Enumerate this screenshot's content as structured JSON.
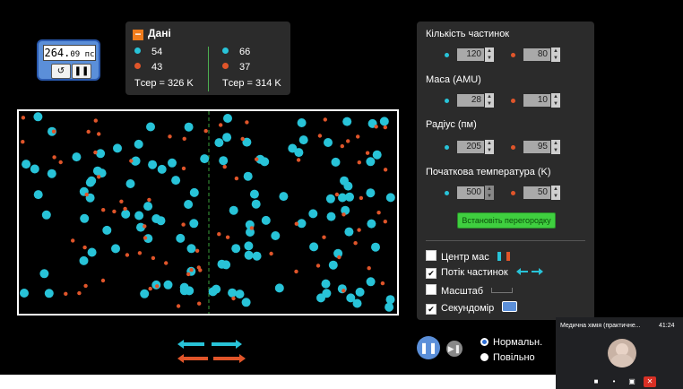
{
  "stopwatch": {
    "value": "264.",
    "decimals": "09",
    "unit": " пс",
    "reset_icon": "reset-icon",
    "pause_icon": "pause-icon"
  },
  "data_panel": {
    "title": "Дані",
    "left": {
      "blue_count": "54",
      "red_count": "43",
      "t_avg": "Tсер = 326 K"
    },
    "right": {
      "blue_count": "66",
      "red_count": "37",
      "t_avg": "Tсер = 314 K"
    }
  },
  "controls": {
    "count_label": "Кількість частинок",
    "count_blue": "120",
    "count_red": "80",
    "mass_label": "Маса (AMU)",
    "mass_blue": "28",
    "mass_red": "10",
    "radius_label": "Радіус (пм)",
    "radius_blue": "205",
    "radius_red": "95",
    "temp_label": "Початкова температура (K)",
    "temp_blue": "500",
    "temp_red": "50",
    "partition_button": "Встановіть перегородку",
    "checkboxes": [
      {
        "label": "Центр мас",
        "checked": false
      },
      {
        "label": "Потік частинок",
        "checked": true
      },
      {
        "label": "Масштаб",
        "checked": false
      },
      {
        "label": "Секундомір",
        "checked": true
      }
    ],
    "scale_text": "​пм"
  },
  "playback": {
    "speed_normal": "Нормальн.",
    "speed_slow": "Повільно",
    "selected": "Нормальн."
  },
  "video_call": {
    "title": "Медична хімія (практичне...",
    "time": "41:24"
  },
  "colors": {
    "blue_particle": "#28c3d8",
    "red_particle": "#e0552a",
    "accent": "#5b8fd9",
    "partition_green": "#3fcf3f"
  }
}
